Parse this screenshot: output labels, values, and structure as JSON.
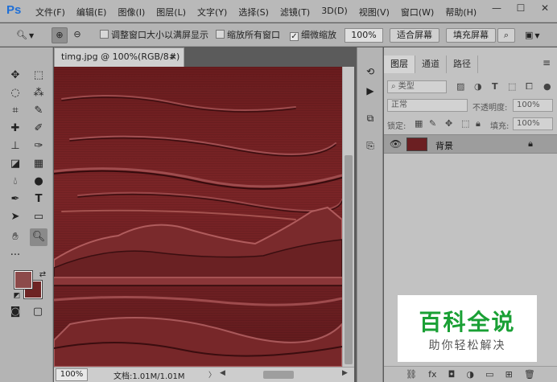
{
  "app": {
    "logo": "Ps"
  },
  "menu": [
    "文件(F)",
    "编辑(E)",
    "图像(I)",
    "图层(L)",
    "文字(Y)",
    "选择(S)",
    "滤镜(T)",
    "3D(D)",
    "视图(V)",
    "窗口(W)",
    "帮助(H)"
  ],
  "window_controls": {
    "minimize": "—",
    "maximize": "☐",
    "close": "✕"
  },
  "options": {
    "resize_windows_label": "调整窗口大小以满屏显示",
    "resize_windows_checked": false,
    "zoom_all_label": "缩放所有窗口",
    "zoom_all_checked": false,
    "scrubby_zoom_label": "细微缩放",
    "scrubby_zoom_checked": true,
    "zoom_value": "100%",
    "fit_screen_label": "适合屏幕",
    "fill_screen_label": "填充屏幕"
  },
  "document": {
    "tab_title": "timg.jpg @ 100%(RGB/8#) *",
    "tab_close": "×",
    "status_zoom": "100%",
    "status_info": "文档:1.01M/1.01M"
  },
  "layers_panel": {
    "tabs": [
      "图层",
      "通道",
      "路径"
    ],
    "active_tab": "图层",
    "filter_kind": "类型",
    "blend_mode": "正常",
    "opacity_label": "不透明度:",
    "opacity_value": "100%",
    "lock_label": "锁定:",
    "fill_label": "填充:",
    "fill_value": "100%",
    "layers": [
      {
        "name": "背景",
        "visible": true,
        "locked": true
      }
    ]
  },
  "watermark": {
    "title": "百科全说",
    "subtitle": "助你轻松解决"
  },
  "colors": {
    "foreground": "#8c4a4a",
    "background": "#6e2424",
    "canvas": "#6a1c1e",
    "watermark_green": "#1aa035"
  }
}
